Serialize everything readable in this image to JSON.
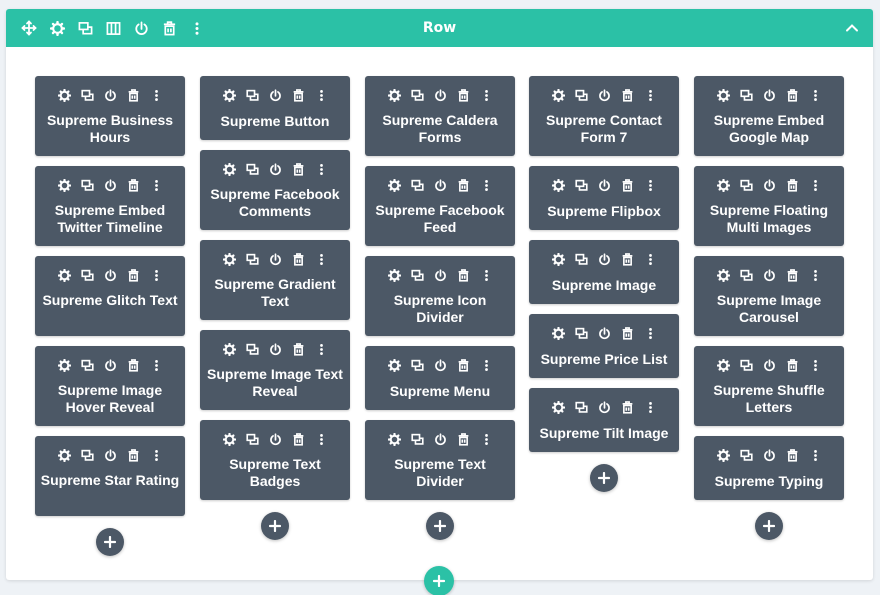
{
  "row": {
    "title": "Row",
    "tool_icons": [
      "move-icon",
      "gear-icon",
      "duplicate-icon",
      "columns-icon",
      "power-icon",
      "trash-icon",
      "more-icon"
    ],
    "collapse_icon": "chevron-up-icon"
  },
  "module_tool_icons": [
    "gear-icon",
    "duplicate-icon",
    "power-icon",
    "trash-icon",
    "more-icon"
  ],
  "columns": [
    {
      "modules": [
        "Supreme Business Hours",
        "Supreme Embed Twitter Timeline",
        "Supreme Glitch Text",
        "Supreme Image Hover Reveal",
        "Supreme Star Rating"
      ]
    },
    {
      "modules": [
        "Supreme Button",
        "Supreme Facebook Comments",
        "Supreme Gradient Text",
        "Supreme Image Text Reveal",
        "Supreme Text Badges"
      ]
    },
    {
      "modules": [
        "Supreme Caldera Forms",
        "Supreme Facebook Feed",
        "Supreme Icon Divider",
        "Supreme Menu",
        "Supreme Text Divider"
      ]
    },
    {
      "modules": [
        "Supreme Contact Form 7",
        "Supreme Flipbox",
        "Supreme Image",
        "Supreme Price List",
        "Supreme Tilt Image"
      ]
    },
    {
      "modules": [
        "Supreme Embed Google Map",
        "Supreme Floating Multi Images",
        "Supreme Image Carousel",
        "Supreme Shuffle Letters",
        "Supreme Typing"
      ]
    }
  ],
  "colors": {
    "accent": "#2bc1a6",
    "module_bg": "#4c5866",
    "text": "#ffffff"
  }
}
